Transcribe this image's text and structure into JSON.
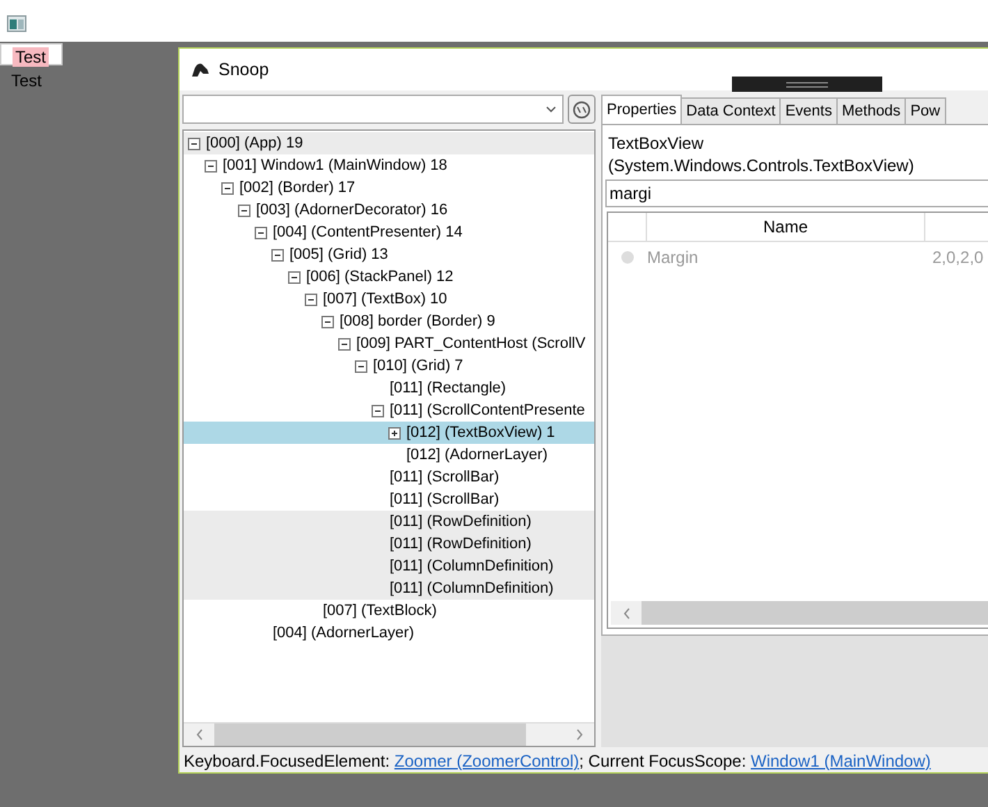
{
  "desktop": {
    "textbox_value": "Test",
    "label": "Test"
  },
  "window": {
    "title": "Snoop"
  },
  "tree": [
    {
      "label": "[000]  (App) 19",
      "expanded": true,
      "selected": false,
      "shaded": true,
      "children": [
        {
          "label": "[001] Window1 (MainWindow) 18",
          "expanded": true,
          "selected": false,
          "shaded": false,
          "children": [
            {
              "label": "[002]  (Border) 17",
              "expanded": true,
              "selected": false,
              "shaded": false,
              "children": [
                {
                  "label": "[003]  (AdornerDecorator) 16",
                  "expanded": true,
                  "selected": false,
                  "shaded": false,
                  "children": [
                    {
                      "label": "[004]  (ContentPresenter) 14",
                      "expanded": true,
                      "selected": false,
                      "shaded": false,
                      "children": [
                        {
                          "label": "[005]  (Grid) 13",
                          "expanded": true,
                          "selected": false,
                          "shaded": false,
                          "children": [
                            {
                              "label": "[006]  (StackPanel) 12",
                              "expanded": true,
                              "selected": false,
                              "shaded": false,
                              "children": [
                                {
                                  "label": "[007]  (TextBox) 10",
                                  "expanded": true,
                                  "selected": false,
                                  "shaded": false,
                                  "children": [
                                    {
                                      "label": "[008] border (Border) 9",
                                      "expanded": true,
                                      "selected": false,
                                      "shaded": false,
                                      "children": [
                                        {
                                          "label": "[009] PART_ContentHost (ScrollV",
                                          "expanded": true,
                                          "selected": false,
                                          "shaded": false,
                                          "children": [
                                            {
                                              "label": "[010]  (Grid) 7",
                                              "expanded": true,
                                              "selected": false,
                                              "shaded": false,
                                              "children": [
                                                {
                                                  "label": "[011]  (Rectangle)",
                                                  "selected": false,
                                                  "shaded": false
                                                },
                                                {
                                                  "label": "[011]  (ScrollContentPresente",
                                                  "expanded": true,
                                                  "selected": false,
                                                  "shaded": false,
                                                  "children": [
                                                    {
                                                      "label": "[012]  (TextBoxView) 1",
                                                      "expanded": false,
                                                      "selected": true,
                                                      "shaded": false
                                                    },
                                                    {
                                                      "label": "[012]  (AdornerLayer)",
                                                      "selected": false,
                                                      "shaded": false
                                                    }
                                                  ]
                                                },
                                                {
                                                  "label": "[011]  (ScrollBar)",
                                                  "selected": false,
                                                  "shaded": false
                                                },
                                                {
                                                  "label": "[011]  (ScrollBar)",
                                                  "selected": false,
                                                  "shaded": false
                                                },
                                                {
                                                  "label": "[011]  (RowDefinition)",
                                                  "selected": false,
                                                  "shaded": true
                                                },
                                                {
                                                  "label": "[011]  (RowDefinition)",
                                                  "selected": false,
                                                  "shaded": true
                                                },
                                                {
                                                  "label": "[011]  (ColumnDefinition)",
                                                  "selected": false,
                                                  "shaded": true
                                                },
                                                {
                                                  "label": "[011]  (ColumnDefinition)",
                                                  "selected": false,
                                                  "shaded": true
                                                }
                                              ]
                                            }
                                          ]
                                        }
                                      ]
                                    }
                                  ]
                                },
                                {
                                  "label": "[007]  (TextBlock)",
                                  "selected": false,
                                  "shaded": false
                                }
                              ]
                            }
                          ]
                        }
                      ]
                    },
                    {
                      "label": "[004]  (AdornerLayer)",
                      "selected": false,
                      "shaded": false
                    }
                  ]
                }
              ]
            }
          ]
        }
      ]
    }
  ],
  "tabs": [
    {
      "label": "Properties",
      "selected": true
    },
    {
      "label": "Data Context",
      "selected": false
    },
    {
      "label": "Events",
      "selected": false
    },
    {
      "label": "Methods",
      "selected": false
    },
    {
      "label": "Pow",
      "selected": false
    }
  ],
  "element_type": "TextBoxView",
  "element_class": "(System.Windows.Controls.TextBoxView)",
  "filter": {
    "value": "margi"
  },
  "grid": {
    "columns": [
      "Name"
    ],
    "rows": [
      {
        "name": "Margin",
        "value": "2,0,2,0"
      }
    ]
  },
  "status_bar": [
    {
      "kind": "text",
      "text": "Keyboard.FocusedElement: "
    },
    {
      "kind": "link",
      "text": "Zoomer (ZoomerControl)"
    },
    {
      "kind": "text",
      "text": "; Current FocusScope: "
    },
    {
      "kind": "link",
      "text": "Window1 (MainWindow)"
    }
  ]
}
